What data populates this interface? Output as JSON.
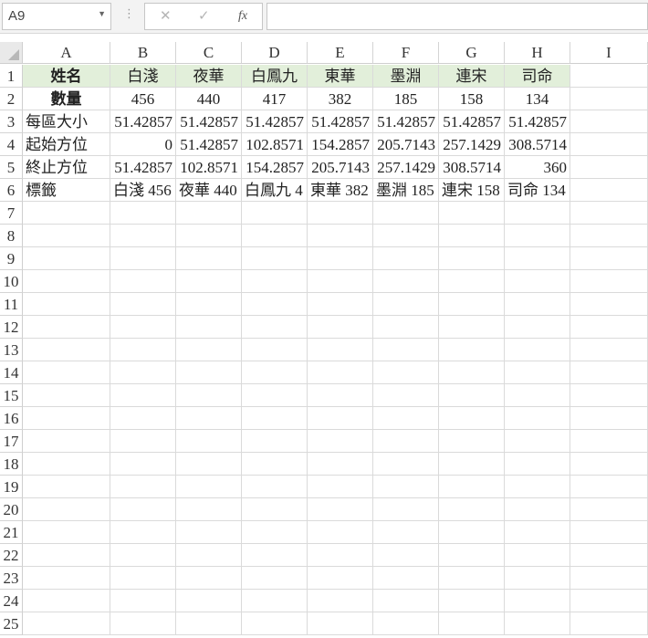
{
  "formula_bar": {
    "name_box": "A9",
    "name_box_dropdown_icon": "chevron-down-icon",
    "cancel_icon": "close-icon",
    "enter_icon": "check-icon",
    "function_label": "fx",
    "formula": ""
  },
  "columns": [
    "A",
    "B",
    "C",
    "D",
    "E",
    "F",
    "G",
    "H",
    "I"
  ],
  "rows": [
    "1",
    "2",
    "3",
    "4",
    "5",
    "6",
    "7",
    "8",
    "9",
    "10",
    "11",
    "12",
    "13",
    "14",
    "15",
    "16",
    "17",
    "18",
    "19",
    "20",
    "21",
    "22",
    "23",
    "24",
    "25"
  ],
  "cells": {
    "r1": [
      "姓名",
      "白淺",
      "夜華",
      "白鳳九",
      "東華",
      "墨淵",
      "連宋",
      "司命"
    ],
    "r2": [
      "數量",
      "456",
      "440",
      "417",
      "382",
      "185",
      "158",
      "134"
    ],
    "r3": [
      "每區大小",
      "51.42857",
      "51.42857",
      "51.42857",
      "51.42857",
      "51.42857",
      "51.42857",
      "51.42857"
    ],
    "r4": [
      "起始方位",
      "0",
      "51.42857",
      "102.8571",
      "154.2857",
      "205.7143",
      "257.1429",
      "308.5714"
    ],
    "r5": [
      "終止方位",
      "51.42857",
      "102.8571",
      "154.2857",
      "205.7143",
      "257.1429",
      "308.5714",
      "360"
    ],
    "r6": [
      "標籤",
      "白淺 456",
      "夜華 440",
      "白鳳九 4",
      "東華 382",
      "墨淵 185",
      "連宋 158",
      "司命 134"
    ]
  },
  "colors": {
    "header_fill": "#e2efda",
    "grid_line": "#dadada"
  }
}
